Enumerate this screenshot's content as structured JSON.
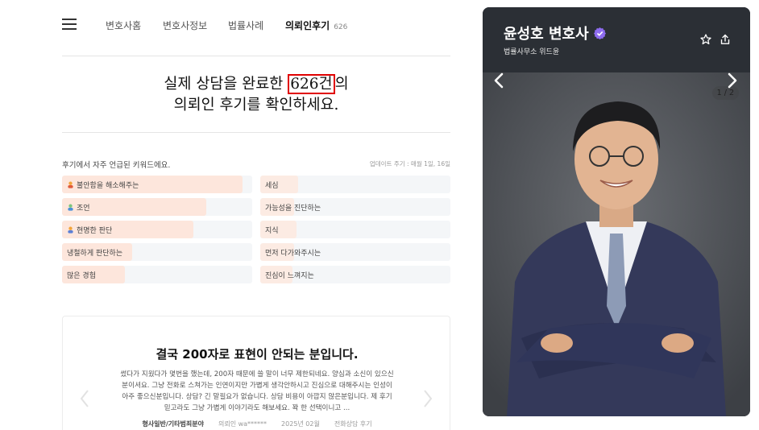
{
  "nav": {
    "tabs": [
      {
        "label": "변호사홈"
      },
      {
        "label": "변호사정보"
      },
      {
        "label": "법률사례"
      },
      {
        "label": "의뢰인후기",
        "count": "626"
      }
    ]
  },
  "headline": {
    "line1_pre": "실제 상담을 완료한 ",
    "line1_highlight": "626건",
    "line1_post": "의",
    "line2": "의뢰인 후기를 확인하세요."
  },
  "keywords": {
    "title": "후기에서 자주 언급된 키워드에요.",
    "update": "업데이트 주기 : 매월 1일, 16일",
    "left": [
      {
        "label": "불안함을 해소해주는",
        "fill": 0.95
      },
      {
        "label": "조언",
        "fill": 0.76
      },
      {
        "label": "현명한 판단",
        "fill": 0.69
      },
      {
        "label": "냉철하게 판단하는",
        "fill": 0.37
      },
      {
        "label": "많은 경험",
        "fill": 0.33
      }
    ],
    "right": [
      {
        "label": "세심",
        "fill": 0.2
      },
      {
        "label": "가능성을 진단하는",
        "fill": 0.18
      },
      {
        "label": "지식",
        "fill": 0.19
      },
      {
        "label": "먼저 다가와주시는",
        "fill": 0.18
      },
      {
        "label": "진심이 느껴지는",
        "fill": 0.17
      }
    ]
  },
  "review": {
    "title": "결국 200자로 표현이 안되는 분입니다.",
    "body": "썼다가 지웠다가 몇번을 했는데, 200자 때문에 쓸 말이 너무 제한되네요. 양심과 소신이 있으신분이셔요. 그냥 전화로 스쳐가는 인연이지만 가볍게 생각안하시고 진심으로 대해주시는 인성이 아주 좋으신분입니다. 상담? 긴 말필요가 없습니다. 상담 비용이 아깝지 않은분입니다. 제 후기 믿고라도 그냥 가볍게 이야기라도 해보세요. 꽉 한 선택이니고 ...",
    "category": "형사일반/기타범죄분야",
    "author": "의뢰인 wa******",
    "date": "2025년 02월",
    "type": "전화상담 후기"
  },
  "profile": {
    "name": "윤성호 변호사",
    "firm": "법률사무소 위드윤",
    "pager": "1 / 2",
    "verified_color": "#8e6cf0"
  },
  "colors": {
    "highlight_box": "#e00000",
    "keyword_fill": "#fde6dc",
    "panel_bg": "#2b2f35"
  }
}
